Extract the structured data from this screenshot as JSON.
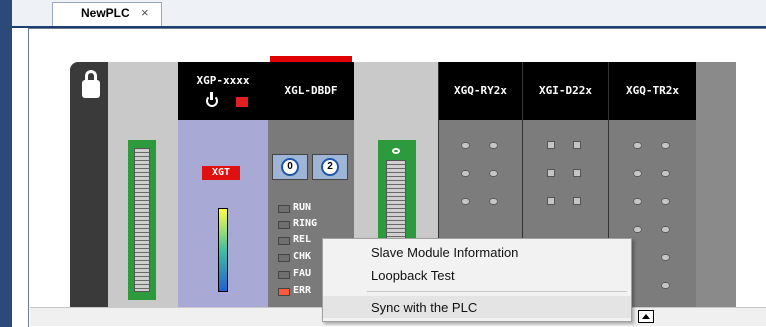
{
  "tab": {
    "label": "NewPLC",
    "close": "×"
  },
  "modules": {
    "cpu": {
      "name": "XGP-xxxx",
      "badge": "XGT"
    },
    "comm": {
      "name": "XGL-DBDF",
      "switch1": "0",
      "switch2": "2",
      "leds": [
        "RUN",
        "RING",
        "REL",
        "CHK",
        "FAU",
        "ERR"
      ]
    },
    "io1": {
      "name": "XGQ-RY2x"
    },
    "io2": {
      "name": "XGI-D22x"
    },
    "io3": {
      "name": "XGQ-TR2x"
    }
  },
  "context_menu": {
    "items": [
      "Slave Module Information",
      "Loopback Test",
      "Sync with the PLC"
    ]
  },
  "colors": {
    "accent": "#1e3f72",
    "cpu_body": "#a9a9d6",
    "board": "#2e9a3e",
    "error_led": "#ff5a3a"
  }
}
